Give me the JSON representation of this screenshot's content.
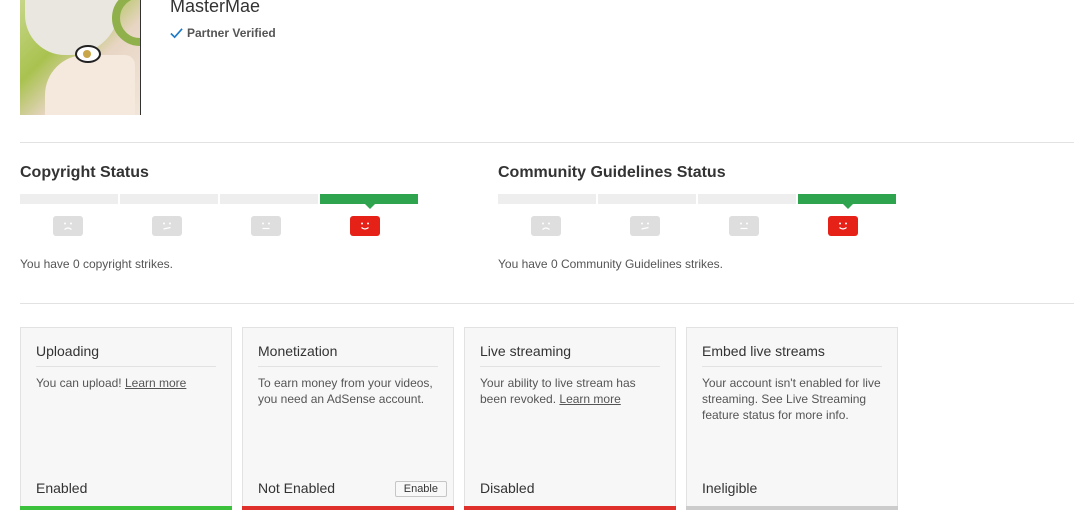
{
  "channel": {
    "name": "MasterMae",
    "verified_label": "Partner Verified"
  },
  "copyright": {
    "title": "Copyright Status",
    "strikes_text": "You have 0 copyright strikes."
  },
  "community": {
    "title": "Community Guidelines Status",
    "strikes_text": "You have 0 Community Guidelines strikes."
  },
  "features": [
    {
      "title": "Uploading",
      "desc": "You can upload!",
      "link": "Learn more",
      "status": "Enabled",
      "bar_color": "#3cc13c"
    },
    {
      "title": "Monetization",
      "desc": "To earn money from your videos, you need an AdSense account.",
      "link": "",
      "status": "Not Enabled",
      "button": "Enable",
      "bar_color": "#e0302c"
    },
    {
      "title": "Live streaming",
      "desc": "Your ability to live stream has been revoked.",
      "link": "Learn more",
      "status": "Disabled",
      "bar_color": "#e0302c"
    },
    {
      "title": "Embed live streams",
      "desc": "Your account isn't enabled for live streaming. See Live Streaming feature status for more info.",
      "link": "",
      "status": "Ineligible",
      "bar_color": "#cccccc"
    }
  ],
  "colors": {
    "good": "#2ea44f",
    "active_face": "#e62117",
    "check": "#1e7ac8"
  }
}
